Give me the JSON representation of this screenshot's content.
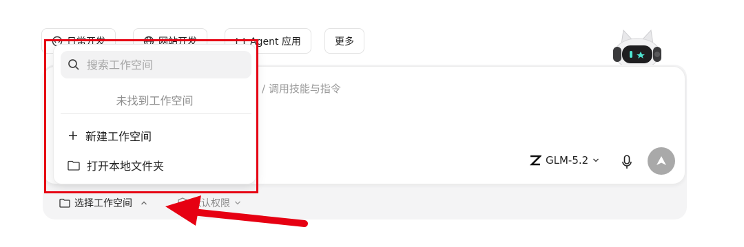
{
  "tabs": [
    {
      "label": "日常开发",
      "icon": "code-icon"
    },
    {
      "label": "网站开发",
      "icon": "globe-icon"
    },
    {
      "label": "Agent 应用",
      "icon": "cat-icon"
    },
    {
      "label": "更多",
      "icon": ""
    }
  ],
  "composer": {
    "hint": "/ 调用技能与指令",
    "model": "GLM-5.2",
    "model_logo": "Z"
  },
  "footer": {
    "workspace_label": "选择工作空间",
    "permission_label": "默认权限"
  },
  "dropdown": {
    "search_placeholder": "搜索工作空间",
    "empty_text": "未找到工作空间",
    "new_workspace": "新建工作空间",
    "open_folder": "打开本地文件夹"
  },
  "colors": {
    "highlight": "#e60012",
    "send_button": "#a9a9a9",
    "composer_bg": "#f4f4f5"
  }
}
